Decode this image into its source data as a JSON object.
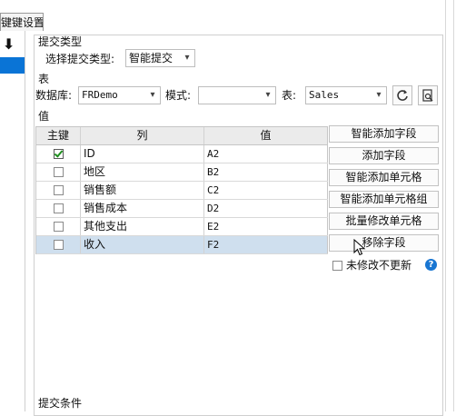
{
  "tab": {
    "label": "键键设置"
  },
  "sidebar": {
    "arrow_glyph": "⬇"
  },
  "submit_type": {
    "section_label": "提交类型",
    "select_label": "选择提交类型:",
    "select_value": "智能提交"
  },
  "table_section": {
    "section_label": "表",
    "database_label": "数据库:",
    "database_value": "FRDemo",
    "schema_label": "模式:",
    "schema_value": "",
    "table_label": "表:",
    "table_value": "Sales"
  },
  "values_section": {
    "section_label": "值",
    "columns": [
      "主键",
      "列",
      "值"
    ],
    "rows": [
      {
        "primary_key": true,
        "column": "ID",
        "value": "A2"
      },
      {
        "primary_key": false,
        "column": "地区",
        "value": "B2"
      },
      {
        "primary_key": false,
        "column": "销售额",
        "value": "C2"
      },
      {
        "primary_key": false,
        "column": "销售成本",
        "value": "D2"
      },
      {
        "primary_key": false,
        "column": "其他支出",
        "value": "E2"
      },
      {
        "primary_key": false,
        "column": "收入",
        "value": "F2"
      }
    ],
    "selected_row": 5
  },
  "actions": {
    "smart_add_field": "智能添加字段",
    "add_field": "添加字段",
    "smart_add_cell": "智能添加单元格",
    "smart_add_cell_group": "智能添加单元格组",
    "batch_modify_cell": "批量修改单元格",
    "remove_field": "移除字段"
  },
  "no_update_unchanged": {
    "label": "未修改不更新",
    "checked": false
  },
  "submit_condition": {
    "section_label": "提交条件"
  },
  "colors": {
    "selection": "#0a74d6",
    "selected_row": "#cfdfee",
    "help": "#1976d2",
    "check": "#1f8f1f"
  }
}
